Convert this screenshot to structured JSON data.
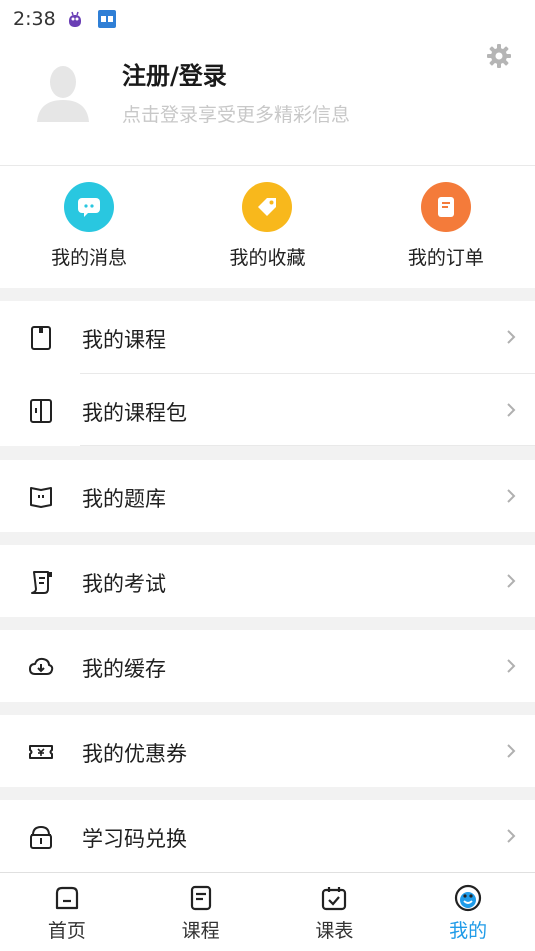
{
  "status_bar": {
    "time": "2:38"
  },
  "profile": {
    "title": "注册/登录",
    "subtitle": "点击登录享受更多精彩信息"
  },
  "quick_actions": [
    {
      "label": "我的消息",
      "icon": "message-icon",
      "color": "#29c7e0"
    },
    {
      "label": "我的收藏",
      "icon": "tag-icon",
      "color": "#f8b81c"
    },
    {
      "label": "我的订单",
      "icon": "order-icon",
      "color": "#f47b3a"
    }
  ],
  "menu": [
    {
      "label": "我的课程",
      "icon": "course-icon"
    },
    {
      "label": "我的课程包",
      "icon": "course-package-icon"
    },
    {
      "label": "我的题库",
      "icon": "question-bank-icon"
    },
    {
      "label": "我的考试",
      "icon": "exam-icon"
    },
    {
      "label": "我的缓存",
      "icon": "cache-download-icon"
    },
    {
      "label": "我的优惠券",
      "icon": "coupon-icon"
    },
    {
      "label": "学习码兑换",
      "icon": "redeem-code-icon"
    }
  ],
  "tabbar": [
    {
      "label": "首页",
      "icon": "home-icon",
      "active": false
    },
    {
      "label": "课程",
      "icon": "course-tab-icon",
      "active": false
    },
    {
      "label": "课表",
      "icon": "schedule-icon",
      "active": false
    },
    {
      "label": "我的",
      "icon": "profile-face-icon",
      "active": true
    }
  ],
  "colors": {
    "accent": "#1f9be8",
    "divider_bg": "#f2f2f2"
  }
}
